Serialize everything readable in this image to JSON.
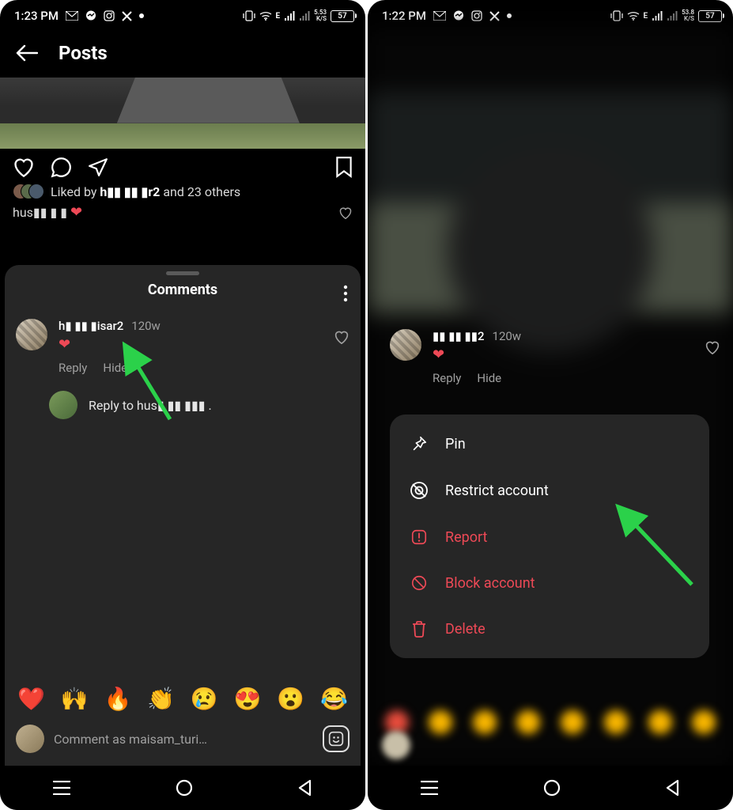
{
  "left": {
    "status": {
      "time": "1:23 PM",
      "net": "5.53",
      "netUnit": "K/S",
      "battery": "57",
      "signal": "E"
    },
    "header": {
      "title": "Posts"
    },
    "likes": {
      "prefix": "Liked by",
      "name": "h▮▮ ▮▮ ▮r2",
      "suffix": "and 23 others"
    },
    "caption": {
      "user": "hus▮▮ ▮ ▮"
    },
    "sheet": {
      "title": "Comments",
      "comment": {
        "user": "h▮ ▮▮ ▮isar2",
        "time": "120w",
        "reply": "Reply",
        "hide": "Hide"
      },
      "replyPreview": {
        "text": "Reply to hus▮ ▮▮ ▮▮▮ ."
      },
      "emojis": [
        "❤️",
        "🙌",
        "🔥",
        "👏",
        "😢",
        "😍",
        "😮",
        "😂"
      ],
      "inputPlaceholder": "Comment as maisam_turi…"
    }
  },
  "right": {
    "status": {
      "time": "1:22 PM",
      "net": "53.8",
      "netUnit": "K/S",
      "battery": "57",
      "signal": "E"
    },
    "comment": {
      "user": "▮▮ ▮▮ ▮▮2",
      "time": "120w",
      "reply": "Reply",
      "hide": "Hide"
    },
    "menu": {
      "pin": "Pin",
      "restrict": "Restrict account",
      "report": "Report",
      "block": "Block account",
      "delete": "Delete"
    }
  }
}
